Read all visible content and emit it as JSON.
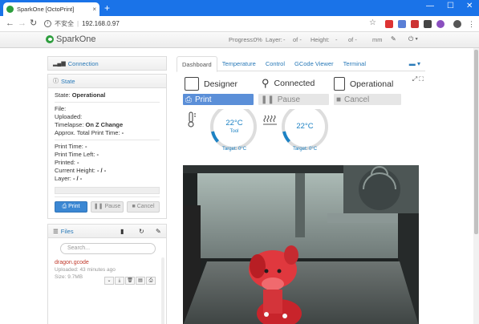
{
  "browser": {
    "tab_title": "SparkOne [OctoPrint]",
    "tab_close": "×",
    "new_tab": "+",
    "security_label": "不安全",
    "url": "192.168.0.97",
    "window_controls": [
      "—",
      "☐",
      "✕"
    ]
  },
  "navbar": {
    "brand": "SparkOne",
    "progress_label": "Progress:",
    "progress_value": "0%",
    "layer_label": "Layer:",
    "layer_value": "-",
    "of1": "of -",
    "height_label": "Height:",
    "height_value": "-",
    "of2": "of -",
    "unit": "mm"
  },
  "sidebar": {
    "connection_label": "Connection",
    "state_label": "State",
    "state": {
      "state_prefix": "State:",
      "state_value": "Operational",
      "file": "File:",
      "uploaded": "Uploaded:",
      "timelapse_prefix": "Timelapse:",
      "timelapse_value": "On Z Change",
      "approx_prefix": "Approx. Total Print Time:",
      "approx_value": "-",
      "print_time_prefix": "Print Time:",
      "print_time_value": "-",
      "print_time_left_prefix": "Print Time Left:",
      "print_time_left_value": "-",
      "printed_prefix": "Printed:",
      "printed_value": "-",
      "current_height_prefix": "Current Height:",
      "current_height_value": "- / -",
      "layer_prefix": "Layer:",
      "layer_value": "- / -"
    },
    "buttons": {
      "print": "Print",
      "pause": "Pause",
      "cancel": "Cancel"
    },
    "files_label": "Files",
    "search_placeholder": "Search...",
    "file": {
      "name": "dragon.gcode",
      "uploaded": "Uploaded: 43 minutes ago",
      "size": "Size: 9.7MB"
    }
  },
  "main": {
    "tabs": [
      {
        "label": "Dashboard"
      },
      {
        "label": "Temperature"
      },
      {
        "label": "Control"
      },
      {
        "label": "GCode Viewer"
      },
      {
        "label": "Terminal"
      }
    ],
    "status": {
      "designer": "Designer",
      "connected": "Connected",
      "operational": "Operational"
    },
    "controls": {
      "print": "Print",
      "pause": "Pause",
      "cancel": "Cancel"
    },
    "tool_gauge": {
      "value": "22°C",
      "label": "Tool",
      "target": "Target: 0°C"
    },
    "bed_gauge": {
      "value": "22°C",
      "target": "Target: 0°C"
    }
  },
  "colors": {
    "accent": "#1a73e8",
    "link": "#2a7ab8",
    "gauge": "#1d82c4",
    "print_button": "#5b8fd8",
    "file_name": "#c0392b"
  }
}
